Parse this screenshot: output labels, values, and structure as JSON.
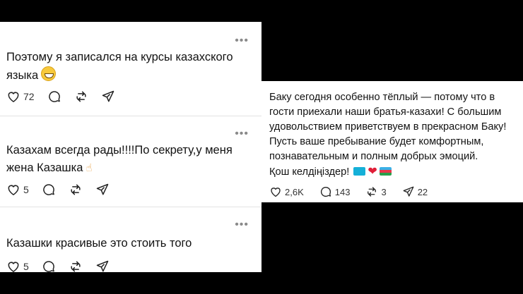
{
  "left_posts": [
    {
      "text": "Поэтому я записался на курсы казахского языка",
      "emoji": "grinning-face-emoji",
      "likes": "72",
      "more": "•••"
    },
    {
      "text": "Казахам всегда рады!!!!По секрету,у меня жена Казашка",
      "emoji": "pointing-up-emoji",
      "likes": "5",
      "more": "•••"
    },
    {
      "text": "Казашки красивые это стоить того",
      "likes": "5",
      "more": "•••"
    }
  ],
  "right_post": {
    "text": "Баку сегодня особенно тёплый — потому что в гости приехали наши братья-казахи! С большим удовольствием приветствуем в прекрасном Баку! Пусть ваше пребывание будет комфортным, познавательным и полным добрых эмоций.",
    "closing": "Қош келдіңіздер!",
    "closing_emojis": [
      "kazakhstan-flag",
      "red-heart",
      "azerbaijan-flag"
    ],
    "likes": "2,6K",
    "comments": "143",
    "reposts": "3",
    "shares": "22"
  },
  "icons": [
    "heart-icon",
    "comment-icon",
    "repost-icon",
    "share-icon",
    "more-icon"
  ],
  "colors": {
    "background": "#000000",
    "panel": "#ffffff",
    "text": "#121212",
    "heart_emoji": "#e01e37"
  }
}
